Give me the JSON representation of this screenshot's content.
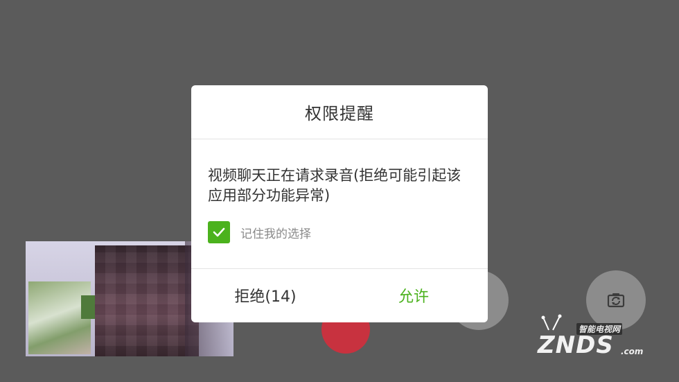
{
  "dialog": {
    "title": "权限提醒",
    "message": "视频聊天正在请求录音(拒绝可能引起该应用部分功能异常)",
    "remember_label": "记住我的选择",
    "remember_checked": true,
    "reject_label": "拒绝(14)",
    "allow_label": "允许"
  },
  "controls": {
    "switch_camera_icon": "camera-switch-icon",
    "hangup_color": "#c8323f"
  },
  "watermark": {
    "top_text": "智能电视网",
    "main_text": "ZNDS",
    "suffix": ".com"
  },
  "colors": {
    "accent": "#4bb21d",
    "backdrop": "#5b5b5b"
  }
}
